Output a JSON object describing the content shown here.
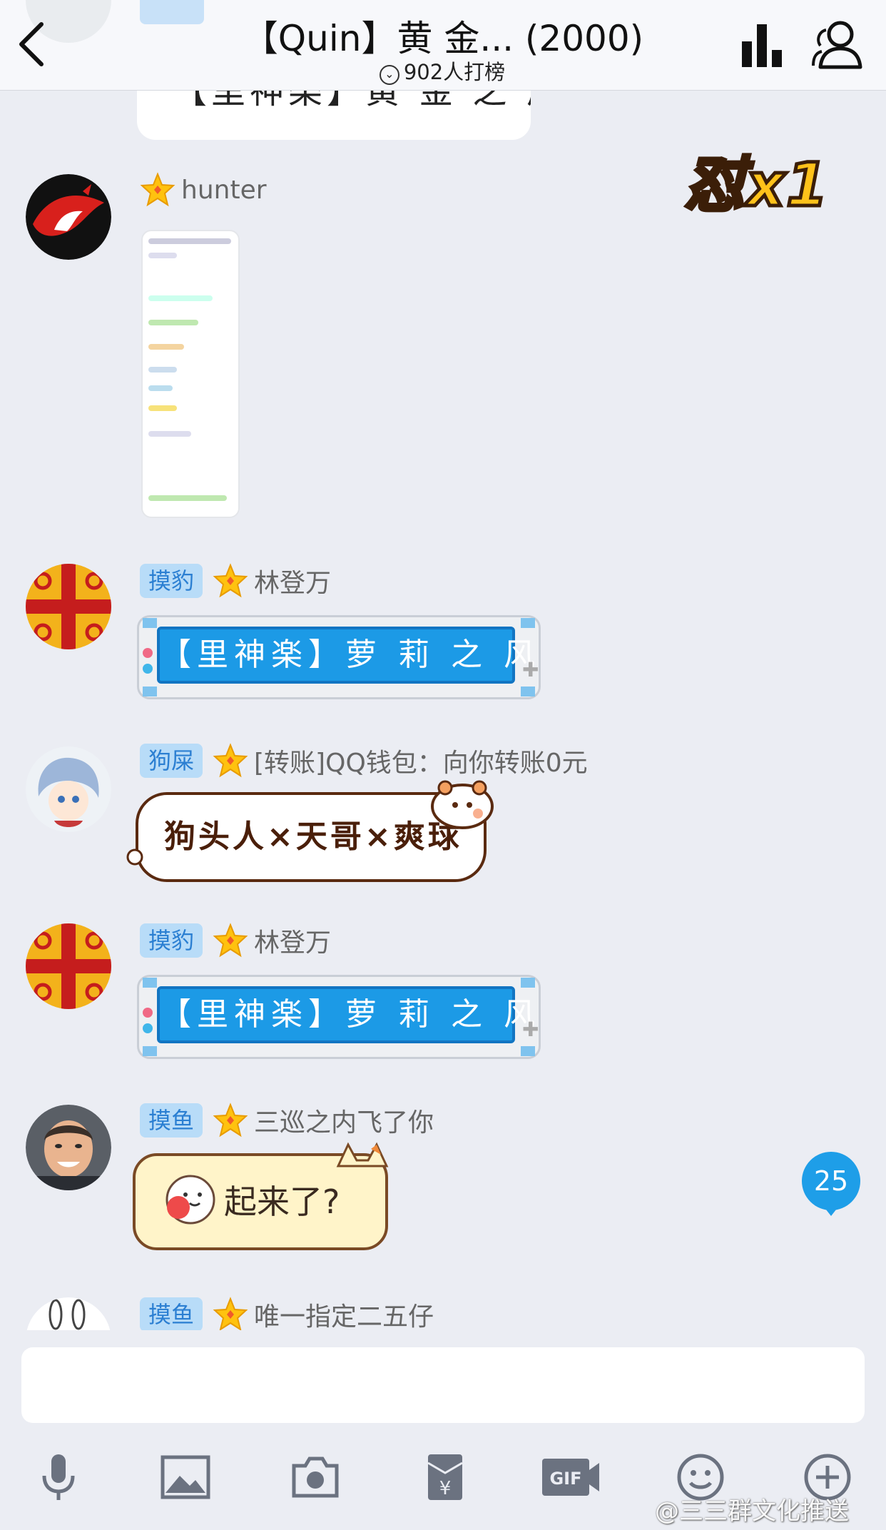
{
  "header": {
    "title": "【Quin】黄 金... (2000)",
    "subtitle": "902人打榜",
    "back_icon": "chevron-left-icon",
    "rank_icon": "bar-chart-icon",
    "members_icon": "group-members-icon"
  },
  "combo": {
    "text": "怼x1"
  },
  "messages": [
    {
      "tag": "",
      "name": "hunter",
      "type": "image",
      "content": ""
    },
    {
      "tag": "摸豹",
      "name": "林登万",
      "type": "gameboy-bubble",
      "content": "【里神楽】萝 莉 之 风"
    },
    {
      "tag": "狗屎",
      "name": "[转账]QQ钱包：向你转账0元",
      "type": "cat-bubble",
      "content": "狗头人×天哥×爽球"
    },
    {
      "tag": "摸豹",
      "name": "林登万",
      "type": "gameboy-bubble",
      "content": "【里神楽】萝 莉 之 风"
    },
    {
      "tag": "摸鱼",
      "name": "三巡之内飞了你",
      "type": "yellow-bubble",
      "content": "起来了?"
    },
    {
      "tag": "摸鱼",
      "name": "唯一指定二五仔",
      "type": "text",
      "content": ""
    }
  ],
  "clipped_top_message": {
    "content": "【里神楽】黄 金 之 风"
  },
  "unread_count": "25",
  "input": {
    "value": "",
    "placeholder": ""
  },
  "toolbar": [
    {
      "icon": "microphone-icon"
    },
    {
      "icon": "image-icon"
    },
    {
      "icon": "camera-icon"
    },
    {
      "icon": "red-packet-icon"
    },
    {
      "icon": "gif-icon"
    },
    {
      "icon": "emoji-icon"
    },
    {
      "icon": "plus-icon"
    }
  ],
  "watermark": "@三三群文化推送",
  "colors": {
    "accent": "#1e9ee8",
    "tag_bg": "#b8dcf8",
    "tag_text": "#2b7fd2",
    "background": "#ebedf3"
  }
}
